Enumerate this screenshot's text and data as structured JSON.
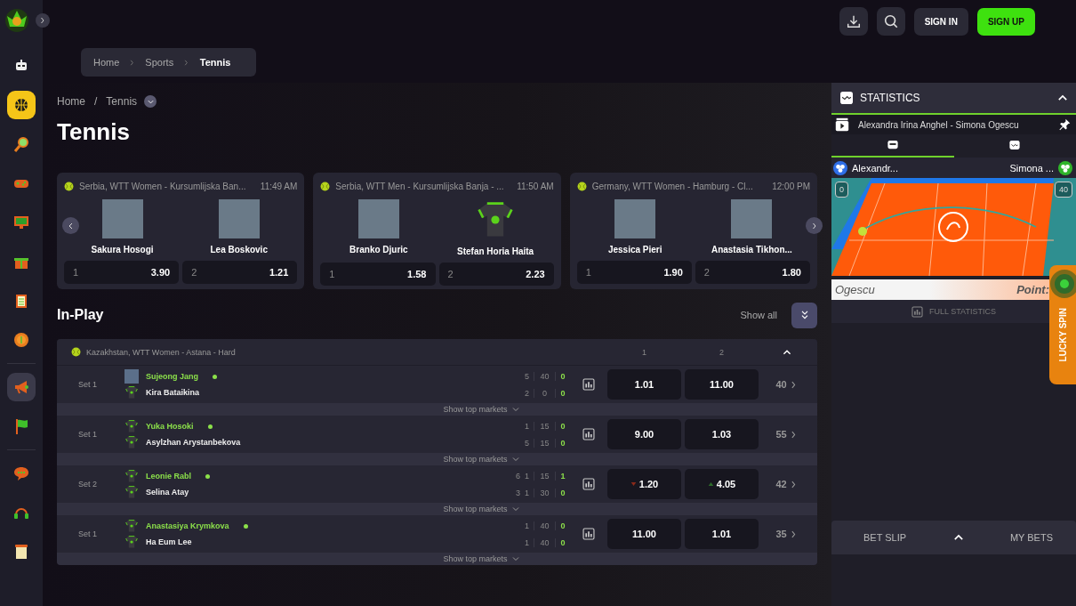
{
  "sidebar": {
    "items": [
      {
        "selected": false,
        "highlighted": false
      },
      {
        "selected": true,
        "highlighted": false
      },
      {
        "selected": false,
        "highlighted": false
      },
      {
        "selected": false,
        "highlighted": false
      },
      {
        "selected": false,
        "highlighted": false
      },
      {
        "selected": false,
        "highlighted": false
      },
      {
        "selected": false,
        "highlighted": false
      },
      {
        "selected": false,
        "highlighted": false
      },
      {
        "selected": false,
        "highlighted": true
      },
      {
        "selected": false,
        "highlighted": false
      },
      {
        "selected": false,
        "highlighted": false
      },
      {
        "selected": false,
        "highlighted": false
      },
      {
        "selected": false,
        "highlighted": false
      }
    ]
  },
  "topbar": {
    "buttons": [
      {
        "label": "SIGN IN",
        "kind": "secondary"
      },
      {
        "label": "SIGN UP",
        "kind": "primary"
      }
    ]
  },
  "breadcrumb": [
    "Home",
    "Sports",
    "Tennis"
  ],
  "page_path": {
    "items": [
      "Home",
      "Tennis"
    ],
    "separator": "/"
  },
  "title": "Tennis",
  "featured": [
    {
      "league": "Serbia, WTT Women - Kursumlijska Ban...",
      "time": "11:49 AM",
      "players": [
        {
          "name": "Sakura Hosogi",
          "kind": "photo"
        },
        {
          "name": "Lea Boskovic",
          "kind": "photo"
        }
      ],
      "odds": [
        {
          "label": "1",
          "value": "3.90"
        },
        {
          "label": "2",
          "value": "1.21"
        }
      ]
    },
    {
      "league": "Serbia, WTT Men - Kursumlijska Banja - ...",
      "time": "11:50 AM",
      "players": [
        {
          "name": "Branko Djuric",
          "kind": "photo"
        },
        {
          "name": "Stefan Horia Haita",
          "kind": "jersey"
        }
      ],
      "odds": [
        {
          "label": "1",
          "value": "1.58"
        },
        {
          "label": "2",
          "value": "2.23"
        }
      ]
    },
    {
      "league": "Germany, WTT Women - Hamburg - Cl...",
      "time": "12:00 PM",
      "players": [
        {
          "name": "Jessica Pieri",
          "kind": "photo"
        },
        {
          "name": "Anastasia Tikhon...",
          "kind": "photo"
        }
      ],
      "odds": [
        {
          "label": "1",
          "value": "1.90"
        },
        {
          "label": "2",
          "value": "1.80"
        }
      ]
    }
  ],
  "in_play": {
    "title": "In-Play",
    "show_all": "Show all",
    "league": "Kazakhstan, WTT Women - Astana - Hard",
    "columns": [
      "1",
      "2"
    ],
    "expanded": true,
    "rows": [
      {
        "set": "Set 1",
        "players": [
          {
            "name": "Sujeong Jang",
            "kind": "photo",
            "serving": true,
            "games": [
              "5"
            ],
            "points": "40",
            "current": "0"
          },
          {
            "name": "Kira Bataikina",
            "kind": "jersey",
            "serving": false,
            "games": [
              "2"
            ],
            "points": "0",
            "current": "0"
          }
        ],
        "odds": [
          {
            "value": "1.01",
            "rising": false,
            "falling": false
          },
          {
            "value": "11.00",
            "rising": false,
            "falling": false
          }
        ],
        "more": "40",
        "markets": "Show top markets"
      },
      {
        "set": "Set 1",
        "players": [
          {
            "name": "Yuka Hosoki",
            "kind": "jersey",
            "serving": true,
            "games": [
              "1"
            ],
            "points": "15",
            "current": "0"
          },
          {
            "name": "Asylzhan Arystanbekova",
            "kind": "jersey",
            "serving": false,
            "games": [
              "5"
            ],
            "points": "15",
            "current": "0"
          }
        ],
        "odds": [
          {
            "value": "9.00",
            "rising": false,
            "falling": false
          },
          {
            "value": "1.03",
            "rising": false,
            "falling": false
          }
        ],
        "more": "55",
        "markets": "Show top markets"
      },
      {
        "set": "Set 2",
        "players": [
          {
            "name": "Leonie Rabl",
            "kind": "jersey",
            "serving": true,
            "games": [
              "6",
              "1"
            ],
            "points": "15",
            "current": "1"
          },
          {
            "name": "Selina Atay",
            "kind": "jersey",
            "serving": false,
            "games": [
              "3",
              "1"
            ],
            "points": "30",
            "current": "0"
          }
        ],
        "odds": [
          {
            "value": "1.20",
            "rising": false,
            "falling": true
          },
          {
            "value": "4.05",
            "rising": true,
            "falling": false
          }
        ],
        "more": "42",
        "markets": "Show top markets"
      },
      {
        "set": "Set 1",
        "players": [
          {
            "name": "Anastasiya Krymkova",
            "kind": "jersey",
            "serving": true,
            "games": [
              "1"
            ],
            "points": "40",
            "current": "0"
          },
          {
            "name": "Ha Eum Lee",
            "kind": "jersey",
            "serving": false,
            "games": [
              "1"
            ],
            "points": "40",
            "current": "0"
          }
        ],
        "odds": [
          {
            "value": "11.00",
            "rising": false,
            "falling": false
          },
          {
            "value": "1.01",
            "rising": false,
            "falling": false
          }
        ],
        "more": "35",
        "markets": "Show top markets"
      }
    ]
  },
  "statistics": {
    "title": "STATISTICS",
    "expanded": true,
    "match": "Alexandra Irina Anghel - Simona Ogescu",
    "tabs": [
      {
        "selected": true
      },
      {
        "selected": false
      }
    ],
    "players": [
      "Alexandr...",
      "Simona ..."
    ],
    "scores": [
      "0",
      "40"
    ],
    "ticker": {
      "name": "Ogescu",
      "label": "Point:"
    },
    "full_stats": "FULL STATISTICS"
  },
  "promo_tab": "LUCKY SPIN",
  "bet_bar": {
    "tabs": [
      "BET SLIP",
      "MY BETS"
    ]
  }
}
